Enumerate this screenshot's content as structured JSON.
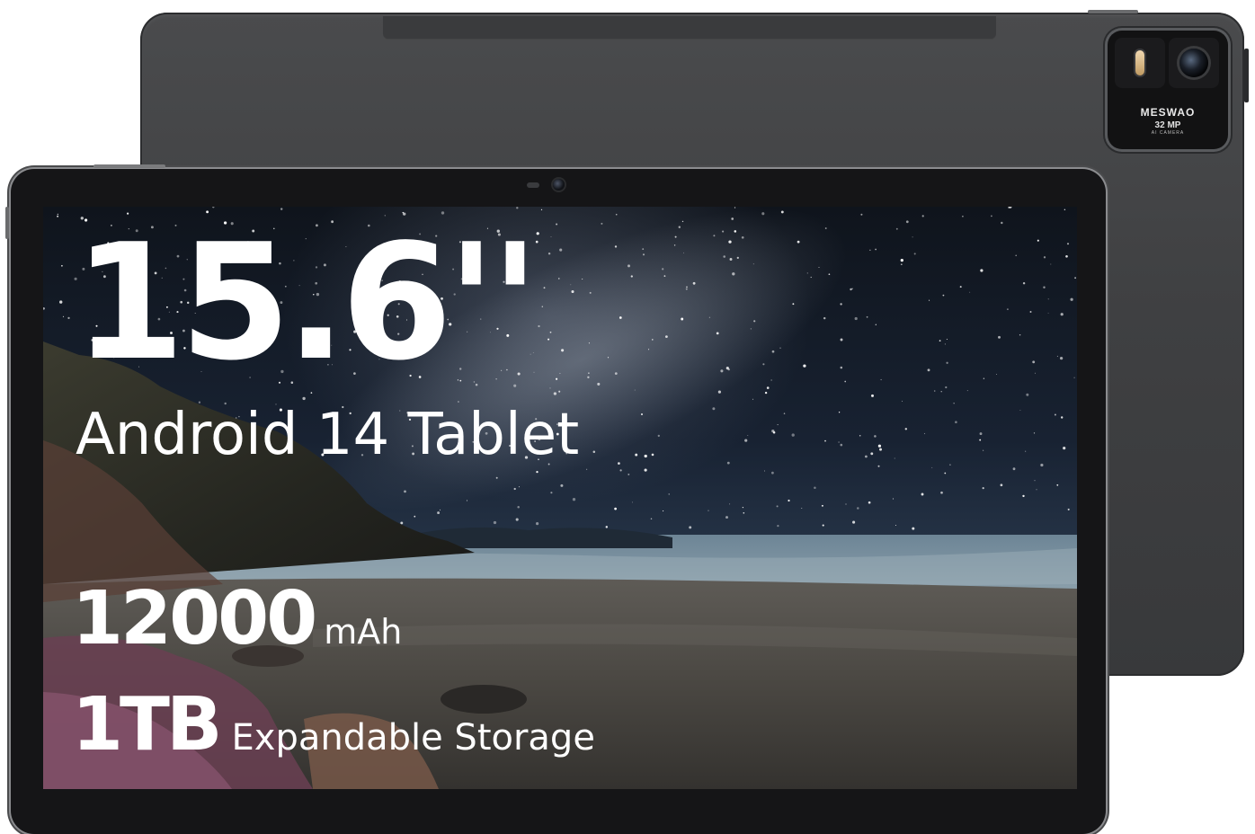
{
  "back_tablet": {
    "camera": {
      "brand": "MESWAO",
      "megapixels": "32 MP",
      "tag": "AI CAMERA"
    }
  },
  "screen": {
    "size": "15.6''",
    "os": "Android 14 Tablet",
    "battery": {
      "value": "12000",
      "unit": "mAh"
    },
    "storage": {
      "value": "1TB",
      "unit": "Expandable Storage"
    }
  }
}
